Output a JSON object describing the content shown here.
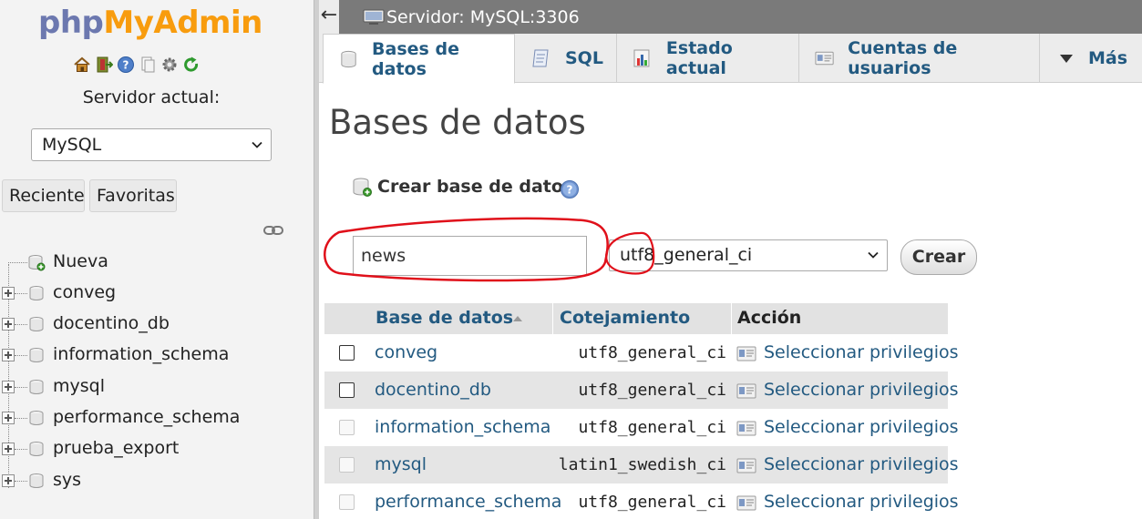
{
  "sidebar": {
    "logo": {
      "php": "php",
      "myadmin": "MyAdmin"
    },
    "quick_icons": [
      "home-icon",
      "exit-icon",
      "help-icon",
      "docs-icon",
      "settings-icon",
      "reload-icon"
    ],
    "server_label": "Servidor actual:",
    "server_select": {
      "selected": "MySQL"
    },
    "recent_label": "Reciente",
    "favorites_label": "Favoritas",
    "tree": {
      "new_label": "Nueva",
      "databases": [
        "conveg",
        "docentino_db",
        "information_schema",
        "mysql",
        "performance_schema",
        "prueba_export",
        "sys"
      ]
    }
  },
  "header": {
    "back_arrow": "←",
    "server_title": "Servidor: MySQL:3306"
  },
  "tabs": [
    {
      "label": "Bases de datos",
      "icon": "database-icon",
      "active": true
    },
    {
      "label": "SQL",
      "icon": "sql-icon",
      "active": false
    },
    {
      "label": "Estado actual",
      "icon": "status-icon",
      "active": false
    },
    {
      "label": "Cuentas de usuarios",
      "icon": "users-icon",
      "active": false
    },
    {
      "label": "Más",
      "icon": "triangle-down-icon",
      "active": false
    }
  ],
  "main": {
    "title": "Bases de datos",
    "create": {
      "heading": "Crear base de datos",
      "name_value": "news",
      "collation_selected": "utf8_general_ci",
      "create_button": "Crear"
    },
    "table": {
      "headers": {
        "database": "Base de datos",
        "collation": "Cotejamiento",
        "action": "Acción"
      },
      "rows": [
        {
          "name": "conveg",
          "collation": "utf8_general_ci",
          "action": "Seleccionar privilegios",
          "checkbox_enabled": true
        },
        {
          "name": "docentino_db",
          "collation": "utf8_general_ci",
          "action": "Seleccionar privilegios",
          "checkbox_enabled": true
        },
        {
          "name": "information_schema",
          "collation": "utf8_general_ci",
          "action": "Seleccionar privilegios",
          "checkbox_enabled": false
        },
        {
          "name": "mysql",
          "collation": "latin1_swedish_ci",
          "action": "Seleccionar privilegios",
          "checkbox_enabled": false
        },
        {
          "name": "performance_schema",
          "collation": "utf8_general_ci",
          "action": "Seleccionar privilegios",
          "checkbox_enabled": false
        }
      ]
    }
  },
  "colors": {
    "link": "#235a81",
    "annotation": "#e0101a",
    "logo_php": "#6c78af",
    "logo_myadmin": "#f89c0e"
  }
}
